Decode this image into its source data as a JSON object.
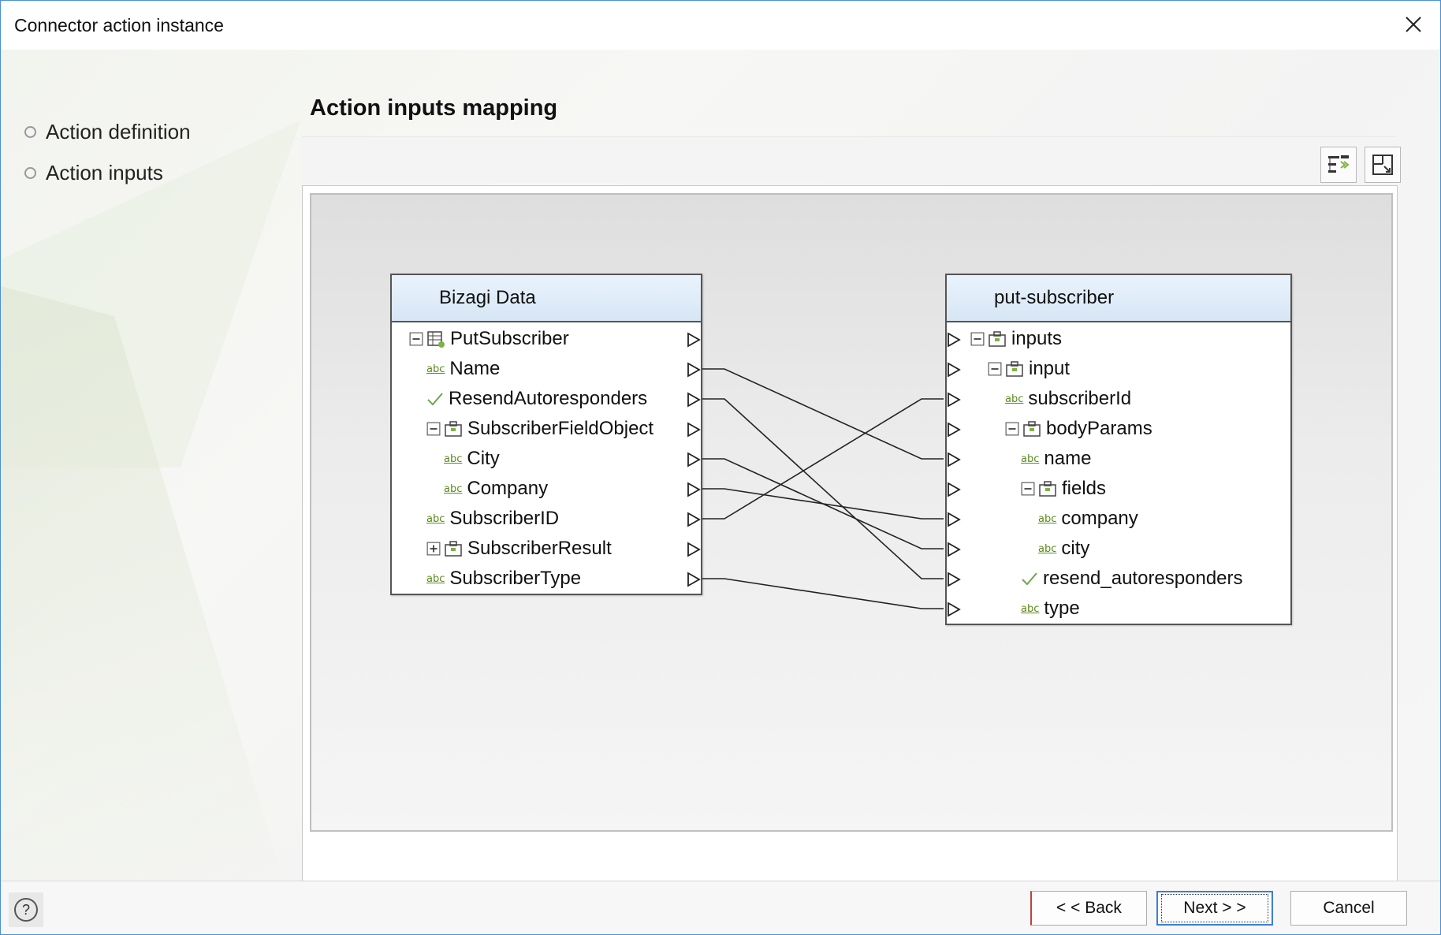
{
  "window": {
    "title": "Connector action instance"
  },
  "steps": [
    {
      "label": "Action definition"
    },
    {
      "label": "Action inputs"
    }
  ],
  "section": {
    "title": "Action inputs mapping"
  },
  "toolbar": {
    "tools": [
      "auto-map-icon",
      "fit-view-icon"
    ]
  },
  "source": {
    "title": "Bizagi Data",
    "rows": [
      {
        "label": "PutSubscriber",
        "icon": "table-icon",
        "expander": "minus"
      },
      {
        "label": "Name",
        "icon": "abc-text-icon"
      },
      {
        "label": "ResendAutoresponders",
        "icon": "checkmark-icon"
      },
      {
        "label": "SubscriberFieldObject",
        "icon": "object-icon",
        "expander": "minus"
      },
      {
        "label": "City",
        "icon": "abc-text-icon"
      },
      {
        "label": "Company",
        "icon": "abc-text-icon"
      },
      {
        "label": "SubscriberID",
        "icon": "abc-text-icon"
      },
      {
        "label": "SubscriberResult",
        "icon": "object-icon",
        "expander": "plus"
      },
      {
        "label": "SubscriberType",
        "icon": "abc-text-icon"
      }
    ]
  },
  "target": {
    "title": "put-subscriber",
    "rows": [
      {
        "label": "inputs",
        "icon": "object-icon",
        "expander": "minus"
      },
      {
        "label": "input",
        "icon": "object-icon",
        "expander": "minus"
      },
      {
        "label": "subscriberId",
        "icon": "abc-text-icon"
      },
      {
        "label": "bodyParams",
        "icon": "object-icon",
        "expander": "minus"
      },
      {
        "label": "name",
        "icon": "abc-text-icon"
      },
      {
        "label": "fields",
        "icon": "object-icon",
        "expander": "minus"
      },
      {
        "label": "company",
        "icon": "abc-text-icon"
      },
      {
        "label": "city",
        "icon": "abc-text-icon"
      },
      {
        "label": "resend_autoresponders",
        "icon": "checkmark-icon"
      },
      {
        "label": "type",
        "icon": "abc-text-icon"
      }
    ]
  },
  "mappings": [
    {
      "from": "Name",
      "to": "name"
    },
    {
      "from": "ResendAutoresponders",
      "to": "resend_autoresponders"
    },
    {
      "from": "City",
      "to": "city"
    },
    {
      "from": "Company",
      "to": "company"
    },
    {
      "from": "SubscriberID",
      "to": "subscriberId"
    },
    {
      "from": "SubscriberType",
      "to": "type"
    }
  ],
  "footer": {
    "help_label": "?",
    "back_label": "< < Back",
    "next_label": "Next > >",
    "cancel_label": "Cancel"
  },
  "colors": {
    "accent": "#3c7fd1",
    "text_icon_green": "#5a8a1a",
    "header_blue": "#d7e6f5"
  }
}
